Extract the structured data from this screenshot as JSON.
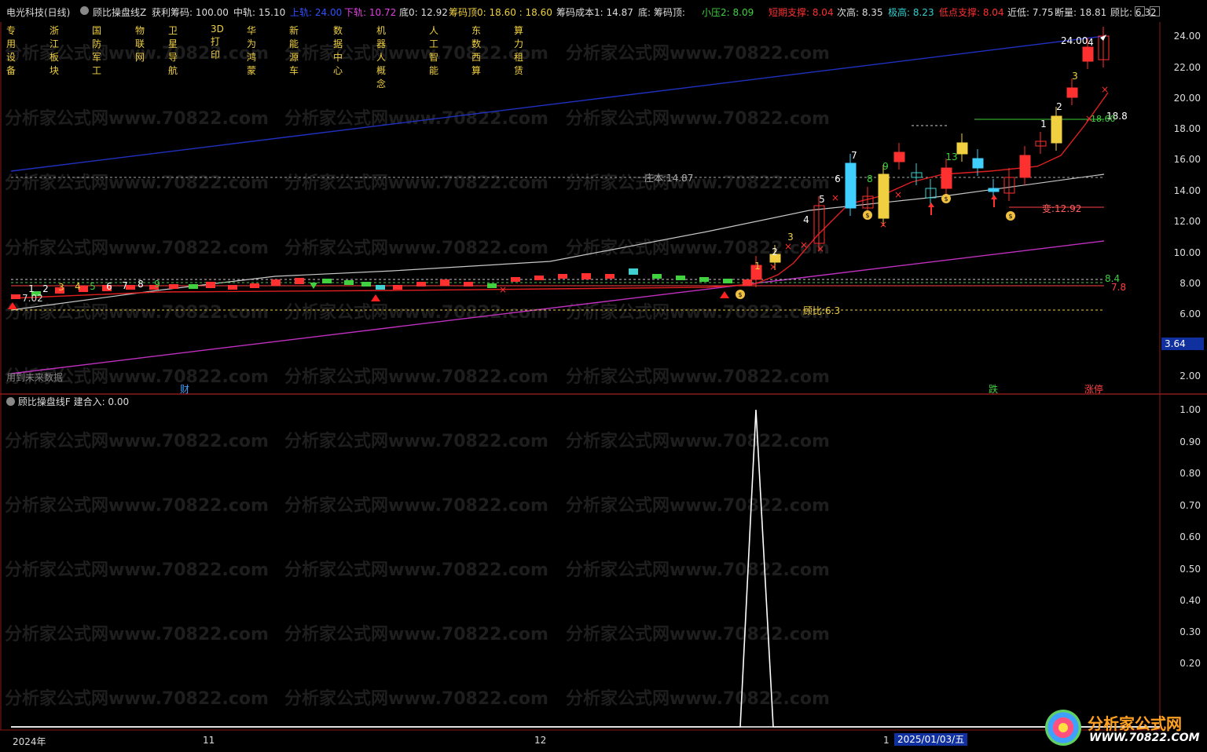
{
  "header": {
    "stock": "电光科技(日线)",
    "indicator": "顾比操盘线Z",
    "items": [
      {
        "text": "获利筹码: 100.00",
        "color": "#dddddd"
      },
      {
        "text": "中轨: 15.10",
        "color": "#dddddd"
      },
      {
        "text": "上轨: 24.00",
        "color": "#3050ff"
      },
      {
        "text": "下轨: 10.72",
        "color": "#e040e0"
      },
      {
        "text": "底0: 12.92",
        "color": "#dddddd"
      },
      {
        "text": "筹码顶0: 18.60 : 18.60",
        "color": "#f0d040"
      },
      {
        "text": "筹码成本1: 14.87",
        "color": "#dddddd"
      },
      {
        "text": "底: 筹码顶:",
        "color": "#dddddd"
      },
      {
        "text": "小压2: 8.09",
        "color": "#40d040"
      },
      {
        "text": "短期支撑: 8.04",
        "color": "#ff3030"
      },
      {
        "text": "次高: 8.35",
        "color": "#dddddd"
      },
      {
        "text": "极高: 8.23",
        "color": "#30d0d0"
      },
      {
        "text": "低点支撑: 8.04",
        "color": "#ff3030"
      },
      {
        "text": "近低: 7.75",
        "color": "#dddddd"
      },
      {
        "text": "断量: 18.81",
        "color": "#dddddd"
      },
      {
        "text": "顾比: 6.32",
        "color": "#dddddd"
      }
    ]
  },
  "sectors": [
    "专用设备",
    "浙江板块",
    "国防军工",
    "物联网",
    "卫星导航",
    "3D打印",
    "华为鸿蒙",
    "新能源车",
    "数据中心",
    "机器人概念",
    "人工智能",
    "东数西算",
    "算力租赁"
  ],
  "price_axis": [
    "24.00",
    "22.00",
    "20.00",
    "18.00",
    "16.00",
    "14.00",
    "12.00",
    "10.00",
    "8.00",
    "6.00",
    "4.00",
    "2.00"
  ],
  "price_badge": "3.64",
  "osc_axis": [
    "1.00",
    "0.90",
    "0.80",
    "0.70",
    "0.60",
    "0.50",
    "0.40",
    "0.30",
    "0.20"
  ],
  "lower_panel": {
    "title": "顾比操盘线F",
    "value": "建合入: 0.00"
  },
  "annotations": {
    "zhuangben": "庄本:14.87",
    "gubi": "顾比:6.3",
    "bian": "变:12.92",
    "left_price": "7.02",
    "high_label": "24.00",
    "r1": "18.8",
    "r2": "8.4",
    "r3": "7.8",
    "r4": "18.60",
    "future": "用到未来数据",
    "cai": "财",
    "die": "跌",
    "zhangting": "涨停"
  },
  "date_axis": [
    "2024年",
    "11",
    "12",
    "1",
    "2025/01/03/五"
  ],
  "watermark": "分析家公式网www.70822.com",
  "logo": {
    "title": "分析家公式网",
    "url": "WWW.70822.COM"
  },
  "chart_data": {
    "type": "candlestick",
    "title": "电光科技(日线)",
    "y_range": [
      2,
      24.5
    ],
    "upper_band_end": 24.0,
    "lower_band_end": 10.72,
    "cost_line": 14.87,
    "gubi_line": 6.32,
    "oscillator": {
      "name": "建合入",
      "range": [
        0,
        1
      ],
      "peak": 1.0
    }
  }
}
